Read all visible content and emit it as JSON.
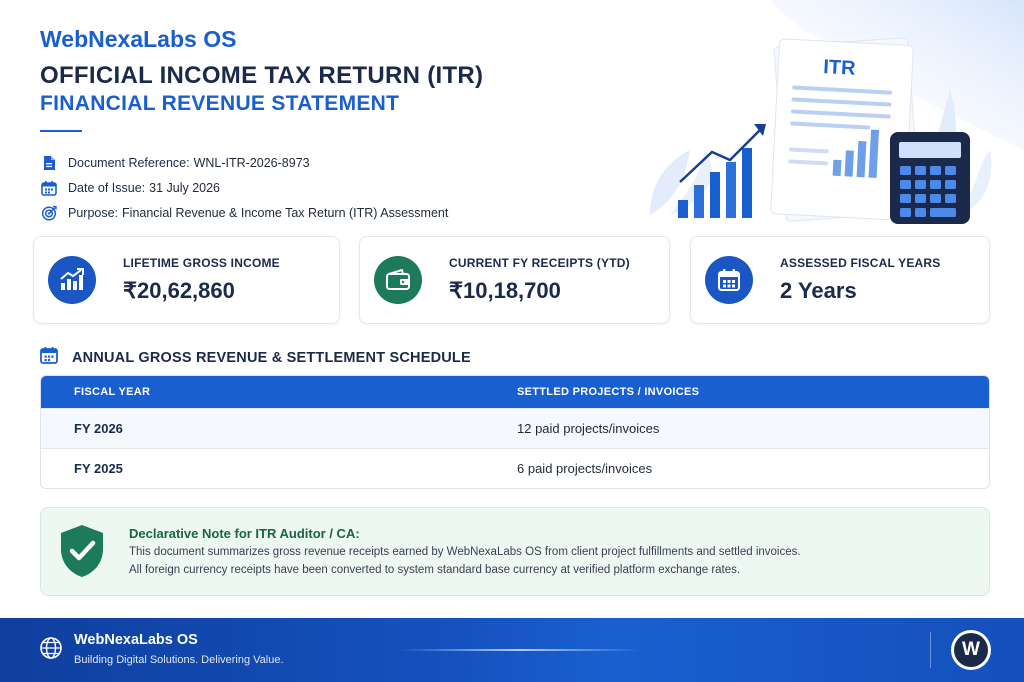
{
  "header": {
    "brand": "WebNexaLabs OS",
    "title": "OFFICIAL INCOME TAX RETURN (ITR)",
    "subtitle": "FINANCIAL REVENUE STATEMENT"
  },
  "meta": [
    {
      "icon": "document-icon",
      "label": "Document Reference:",
      "value": "WNL-ITR-2026-8973"
    },
    {
      "icon": "calendar-icon",
      "label": "Date of Issue:",
      "value": "31 July 2026"
    },
    {
      "icon": "target-icon",
      "label": "Purpose:",
      "value": "Financial Revenue & Income Tax Return (ITR) Assessment"
    }
  ],
  "hero": {
    "doc_label": "ITR"
  },
  "stats": [
    {
      "icon": "growth-chart-icon",
      "color": "#1a56c4",
      "label": "LIFETIME GROSS INCOME",
      "value": "₹20,62,860"
    },
    {
      "icon": "wallet-icon",
      "color": "#1d7a5a",
      "label": "CURRENT FY RECEIPTS (YTD)",
      "value": "₹10,18,700"
    },
    {
      "icon": "calendar-icon",
      "color": "#1a56c4",
      "label": "ASSESSED FISCAL YEARS",
      "value": "2 Years"
    }
  ],
  "schedule": {
    "title": "ANNUAL GROSS REVENUE & SETTLEMENT SCHEDULE",
    "columns": [
      "FISCAL YEAR",
      "SETTLED PROJECTS / INVOICES"
    ],
    "rows": [
      {
        "year": "FY 2026",
        "settled": "12 paid projects/invoices"
      },
      {
        "year": "FY 2025",
        "settled": "6 paid projects/invoices"
      }
    ]
  },
  "note": {
    "title": "Declarative Note for ITR Auditor / CA:",
    "line1": "This document summarizes gross revenue receipts earned by WebNexaLabs OS from client project fulfillments and settled invoices.",
    "line2": "All foreign currency receipts have been converted to system standard base currency at verified platform exchange rates."
  },
  "footer": {
    "brand": "WebNexaLabs OS",
    "tagline": "Building Digital Solutions. Delivering Value.",
    "logo_letter": "W"
  },
  "colors": {
    "primary": "#1a5fcf",
    "navy": "#1b2a4a",
    "green": "#1d7a5a",
    "note_bg": "#eef8f2"
  }
}
